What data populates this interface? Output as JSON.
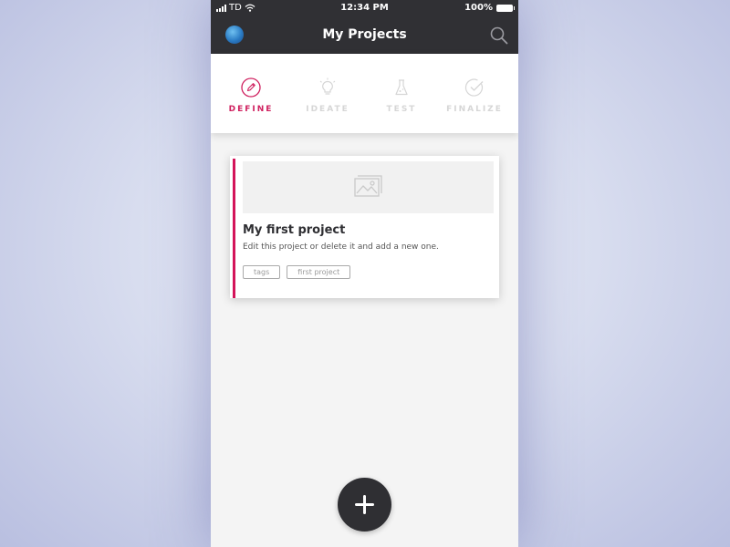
{
  "status_bar": {
    "carrier": "TD",
    "time": "12:34 PM",
    "battery": "100%"
  },
  "header": {
    "title": "My Projects"
  },
  "steps": [
    {
      "label": "DEFINE",
      "icon": "pencil-icon",
      "active": true
    },
    {
      "label": "IDEATE",
      "icon": "lightbulb-icon",
      "active": false
    },
    {
      "label": "TEST",
      "icon": "flask-icon",
      "active": false
    },
    {
      "label": "FINALIZE",
      "icon": "checkmark-icon",
      "active": false
    }
  ],
  "project_card": {
    "title": "My first project",
    "description": "Edit this project or delete it and add a new one.",
    "tags": [
      "tags",
      "first project"
    ],
    "image_icon": "image-placeholder-icon"
  },
  "fab": {
    "icon": "plus-icon"
  },
  "colors": {
    "header_bg": "#303034",
    "accent": "#d4145a",
    "inactive_step": "#d6d6d6",
    "content_bg": "#f4f4f4"
  }
}
